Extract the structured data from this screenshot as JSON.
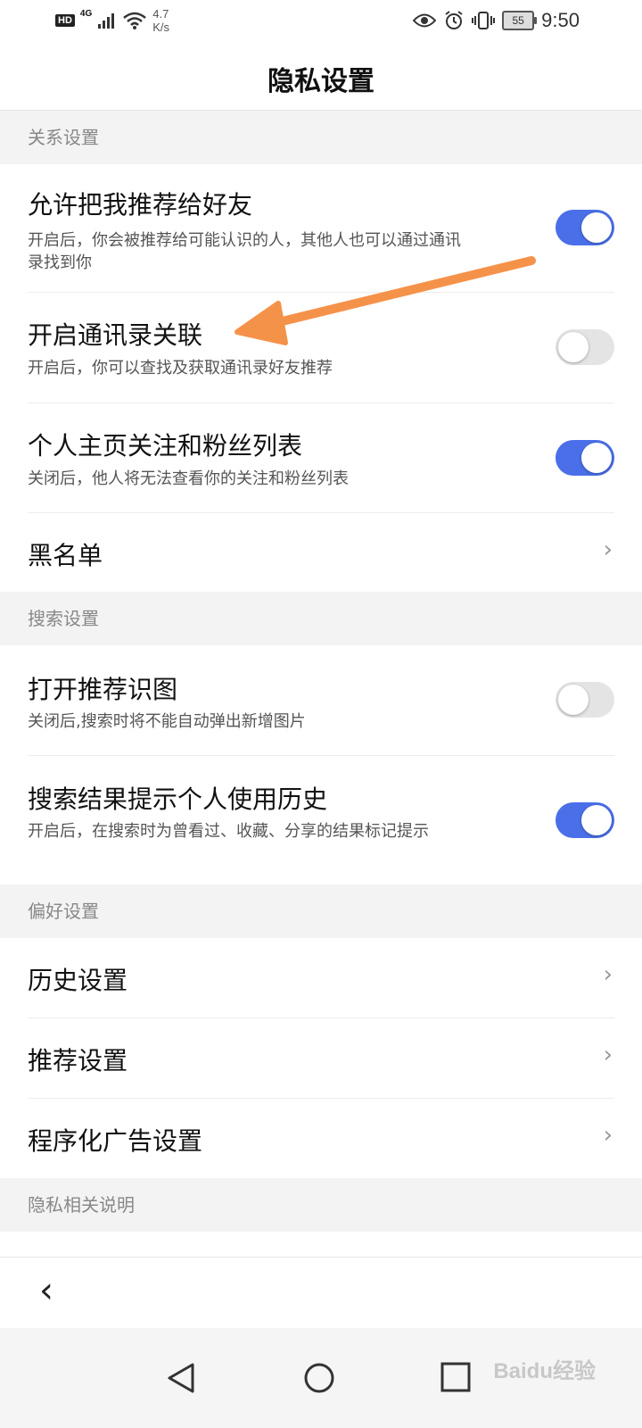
{
  "status_bar": {
    "hd": "HD",
    "network": "4G",
    "speed_value": "4.7",
    "speed_unit": "K/s",
    "battery": "55",
    "time": "9:50"
  },
  "header": {
    "title": "隐私设置"
  },
  "sections": [
    {
      "header": "关系设置",
      "items": [
        {
          "title": "允许把我推荐给好友",
          "desc": "开启后，你会被推荐给可能认识的人，其他人也可以通过通讯录找到你",
          "toggle": "on"
        },
        {
          "title": "开启通讯录关联",
          "desc": "开启后，你可以查找及获取通讯录好友推荐",
          "toggle": "off"
        },
        {
          "title": "个人主页关注和粉丝列表",
          "desc": "关闭后，他人将无法查看你的关注和粉丝列表",
          "toggle": "on"
        },
        {
          "title": "黑名单",
          "chevron": "chevron-right-icon"
        }
      ]
    },
    {
      "header": "搜索设置",
      "items": [
        {
          "title": "打开推荐识图",
          "desc": "关闭后,搜索时将不能自动弹出新增图片",
          "toggle": "off"
        },
        {
          "title": "搜索结果提示个人使用历史",
          "desc": "开启后，在搜索时为曾看过、收藏、分享的结果标记提示",
          "toggle": "on"
        }
      ]
    },
    {
      "header": "偏好设置",
      "items": [
        {
          "title": "历史设置",
          "chevron": "chevron-right-icon"
        },
        {
          "title": "推荐设置",
          "chevron": "chevron-right-icon"
        },
        {
          "title": "程序化广告设置",
          "chevron": "chevron-right-icon"
        }
      ]
    },
    {
      "header": "隐私相关说明"
    }
  ],
  "watermark": "Baidu经验",
  "colors": {
    "toggle_on": "#4a6fe8",
    "toggle_off": "#e4e4e4",
    "annotation_arrow": "#f5924a"
  }
}
